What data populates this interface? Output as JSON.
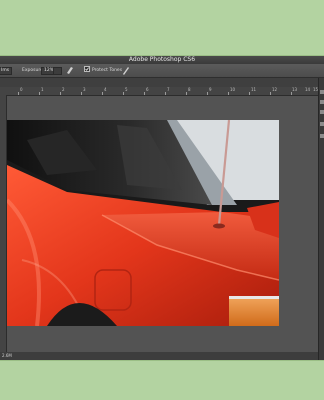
{
  "window": {
    "title": "Adobe Photoshop CS6"
  },
  "options_bar": {
    "tool_mode": "Ims",
    "exposure_label": "Exposure:",
    "exposure_value": "12%",
    "protect_tones_label": "Protect Tones",
    "protect_tones_checked": true
  },
  "ruler": {
    "ticks": [
      "0",
      "1",
      "2",
      "3",
      "4",
      "5",
      "6",
      "7",
      "8",
      "9",
      "10",
      "11",
      "12",
      "13",
      "14",
      "15"
    ]
  },
  "status_bar": {
    "zoom": "2.6M"
  },
  "colors": {
    "background": "#b3d3a1",
    "window": "#535353",
    "car_red": "#e83a1f"
  },
  "icons": [
    "eyedropper-icon",
    "brush-icon",
    "panel-icon"
  ]
}
